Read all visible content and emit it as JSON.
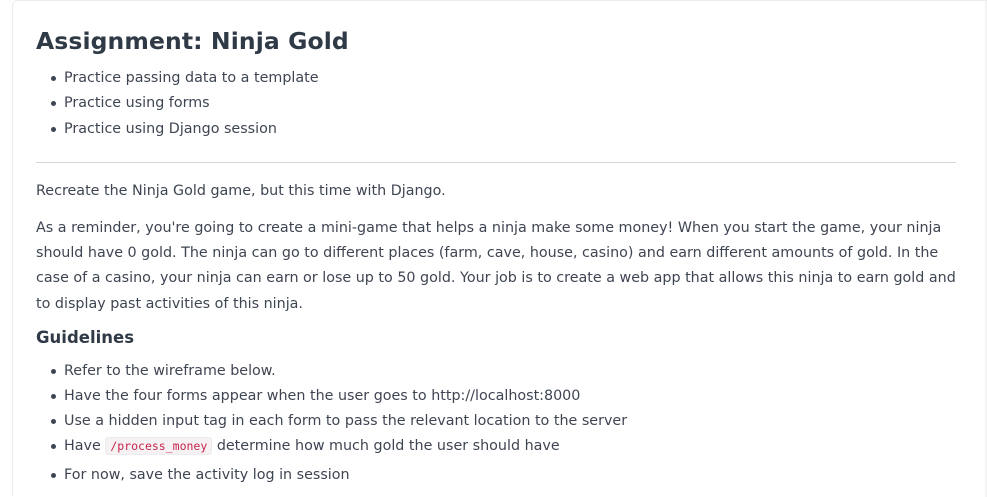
{
  "assignment": {
    "title": "Assignment: Ninja Gold",
    "objectives": [
      "Practice passing data to a template",
      "Practice using forms",
      "Practice using Django session"
    ],
    "intro": "Recreate the Ninja Gold game, but this time with Django.",
    "reminder": "As a reminder, you're going to create a mini-game that helps a ninja make some money! When you start the game, your ninja should have 0 gold. The ninja can go to different places (farm, cave, house, casino) and earn different amounts of gold. In the case of a casino, your ninja can earn or lose up to 50 gold. Your job is to create a web app that allows this ninja to earn gold and to display past activities of this ninja.",
    "guidelines_heading": "Guidelines",
    "guidelines": {
      "g1": "Refer to the wireframe below.",
      "g2": "Have the four forms appear when the user goes to http://localhost:8000",
      "g3": "Use a hidden input tag in each form to pass the relevant location to the server",
      "g4_prefix": "Have",
      "g4_code": "/process_money",
      "g4_suffix": "determine how much gold the user should have",
      "g5": "For now, save the activity log in session"
    }
  },
  "colors": {
    "heading": "#2f3a46",
    "body_text": "#3e4552",
    "divider": "#d3d6da",
    "inline_code": "#c7254e"
  }
}
